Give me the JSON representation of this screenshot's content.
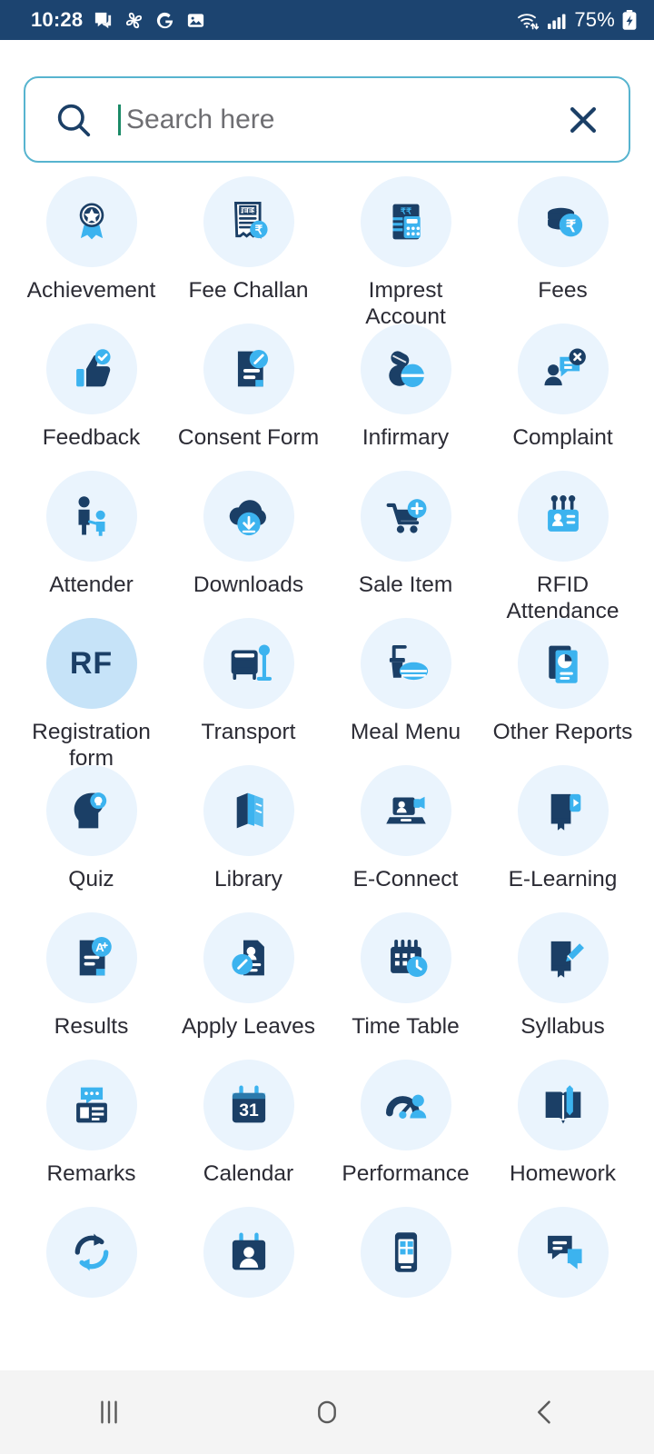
{
  "status_bar": {
    "time": "10:28",
    "battery_percent": "75%",
    "left_icons": [
      "chat-bubble-icon",
      "pinwheel-icon",
      "google-g-icon",
      "gallery-icon"
    ],
    "right_icons": [
      "wifi-icon",
      "signal-bars-icon",
      "battery-charging-icon"
    ],
    "background_color": "#1c4470",
    "text_color": "#ffffff"
  },
  "search": {
    "placeholder": "Search here",
    "value": "",
    "cursor_visible": true,
    "cursor_color": "#1b8a67",
    "border_color": "#57b4cf",
    "search_icon": "search-icon",
    "clear_icon": "close-icon"
  },
  "theme": {
    "disc_bg": "#eaf4fd",
    "disc_bg_accent": "#c6e3f8",
    "icon_dark": "#1b3f66",
    "icon_light": "#3cb3ef",
    "label_color": "#2b2b34"
  },
  "grid": {
    "columns": 4,
    "items": [
      {
        "label": "Achievement",
        "icon": "award-ribbon-icon",
        "accent": false
      },
      {
        "label": "Fee Challan",
        "icon": "fee-receipt-icon",
        "accent": false
      },
      {
        "label": "Imprest Account",
        "icon": "ledger-calculator-icon",
        "accent": false
      },
      {
        "label": "Fees",
        "icon": "coins-rupee-icon",
        "accent": false
      },
      {
        "label": "Feedback",
        "icon": "thumbs-up-check-icon",
        "accent": false
      },
      {
        "label": "Consent Form",
        "icon": "document-edit-icon",
        "accent": false
      },
      {
        "label": "Infirmary",
        "icon": "pills-icon",
        "accent": false
      },
      {
        "label": "Complaint",
        "icon": "person-chat-x-icon",
        "accent": false
      },
      {
        "label": "Attender",
        "icon": "adult-child-icon",
        "accent": false
      },
      {
        "label": "Downloads",
        "icon": "cloud-download-icon",
        "accent": false
      },
      {
        "label": "Sale Item",
        "icon": "cart-plus-icon",
        "accent": false
      },
      {
        "label": "RFID Attendance",
        "icon": "rfid-card-icon",
        "accent": false
      },
      {
        "label": "Registration form",
        "icon": "rf-text-icon",
        "accent": true,
        "text": "RF"
      },
      {
        "label": "Transport",
        "icon": "bus-stop-icon",
        "accent": false
      },
      {
        "label": "Meal Menu",
        "icon": "food-drink-icon",
        "accent": false
      },
      {
        "label": "Other Reports",
        "icon": "report-chart-icon",
        "accent": false
      },
      {
        "label": "Quiz",
        "icon": "head-bulb-icon",
        "accent": false
      },
      {
        "label": "Library",
        "icon": "books-icon",
        "accent": false
      },
      {
        "label": "E-Connect",
        "icon": "laptop-video-icon",
        "accent": false
      },
      {
        "label": "E-Learning",
        "icon": "book-play-icon",
        "accent": false
      },
      {
        "label": "Results",
        "icon": "grade-a-doc-icon",
        "accent": false
      },
      {
        "label": "Apply Leaves",
        "icon": "leave-form-icon",
        "accent": false
      },
      {
        "label": "Time Table",
        "icon": "calendar-clock-icon",
        "accent": false
      },
      {
        "label": "Syllabus",
        "icon": "book-pen-icon",
        "accent": false
      },
      {
        "label": "Remarks",
        "icon": "remark-card-icon",
        "accent": false
      },
      {
        "label": "Calendar",
        "icon": "calendar-31-icon",
        "text": "31",
        "accent": false
      },
      {
        "label": "Performance",
        "icon": "gauge-person-icon",
        "accent": false
      },
      {
        "label": "Homework",
        "icon": "open-book-pencil-icon",
        "accent": false
      },
      {
        "label": "",
        "icon": "sync-icon",
        "accent": false
      },
      {
        "label": "",
        "icon": "calendar-person-icon",
        "accent": false
      },
      {
        "label": "",
        "icon": "mobile-app-icon",
        "accent": false
      },
      {
        "label": "",
        "icon": "chat-messages-icon",
        "accent": false
      }
    ]
  },
  "nav_bar": {
    "recents_label": "|||",
    "home_label": "home-icon",
    "back_label": "back-icon",
    "background_color": "#f4f4f4"
  }
}
